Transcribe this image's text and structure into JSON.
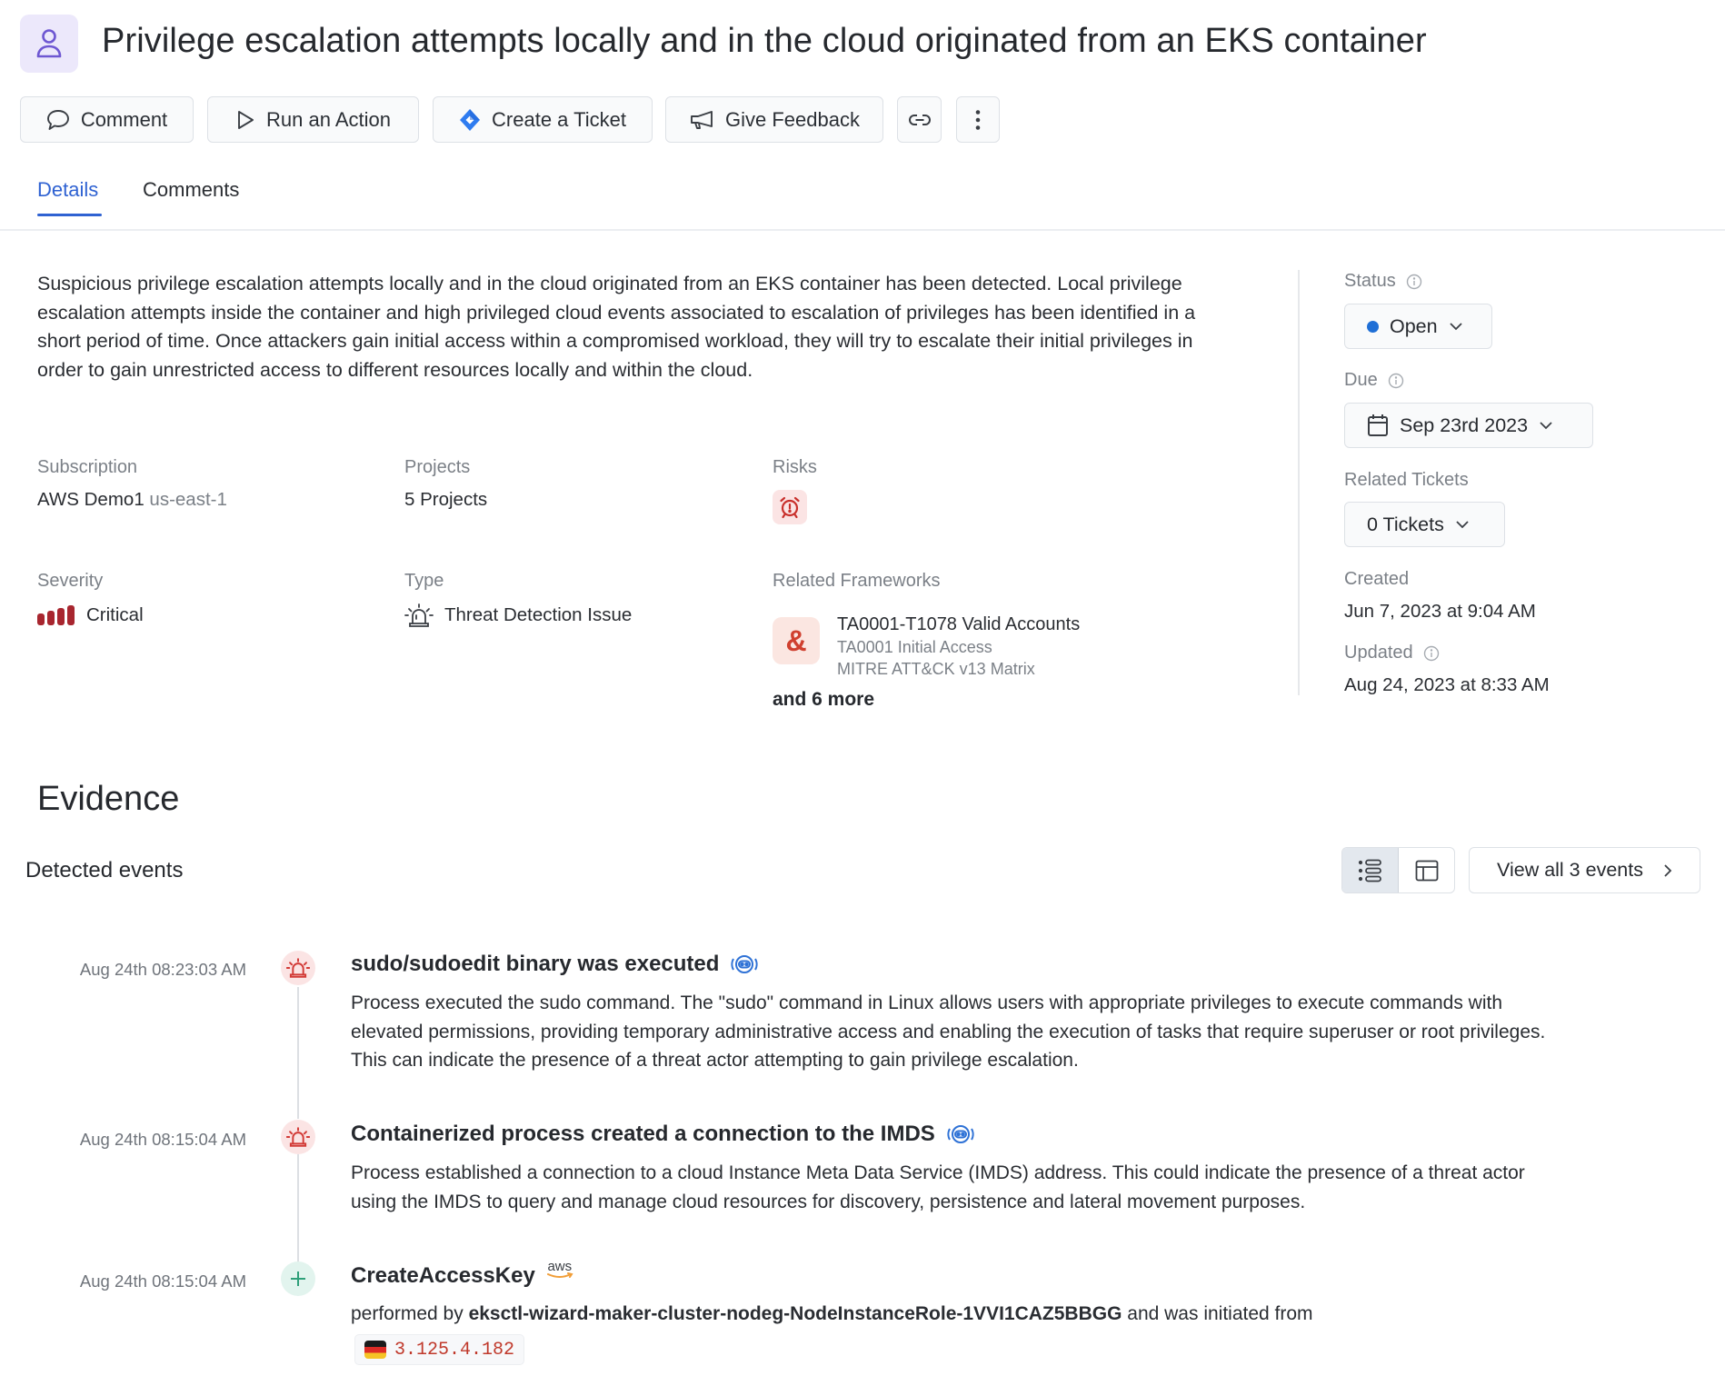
{
  "header": {
    "icon": "user-icon",
    "title": "Privilege escalation attempts locally and in the cloud originated from an EKS container"
  },
  "toolbar": {
    "comment": {
      "label": "Comment",
      "icon": "speech-bubble-icon"
    },
    "run_action": {
      "label": "Run an Action",
      "icon": "play-icon"
    },
    "create_ticket": {
      "label": "Create a Ticket",
      "icon": "jira-icon"
    },
    "give_feedback": {
      "label": "Give Feedback",
      "icon": "megaphone-icon"
    },
    "copy_link": {
      "icon": "link-icon"
    },
    "more": {
      "icon": "more-vertical-icon"
    }
  },
  "tabs": [
    {
      "label": "Details",
      "active": true
    },
    {
      "label": "Comments",
      "active": false
    }
  ],
  "details": {
    "description": "Suspicious privilege escalation attempts locally and in the cloud originated from an EKS container has been detected. Local privilege escalation attempts inside the container and high privileged cloud events associated to escalation of privileges has been identified in a short period of time. Once attackers gain initial access within a compromised workload, they will try to escalate their initial privileges in order to gain unrestricted access to different resources locally and within the cloud.",
    "subscription": {
      "label": "Subscription",
      "name": "AWS Demo1",
      "region": "us-east-1"
    },
    "projects": {
      "label": "Projects",
      "value": "5 Projects"
    },
    "risks": {
      "label": "Risks",
      "icon": "alarm-clock-icon"
    },
    "severity": {
      "label": "Severity",
      "value": "Critical",
      "level": 4,
      "max_level": 4,
      "color": "#a8262f"
    },
    "type": {
      "label": "Type",
      "value": "Threat Detection Issue",
      "icon": "siren-icon"
    },
    "frameworks": {
      "label": "Related Frameworks",
      "item": {
        "icon": "ampersand-icon",
        "title": "TA0001-T1078 Valid Accounts",
        "tactic": "TA0001 Initial Access",
        "matrix": "MITRE ATT&CK v13 Matrix"
      },
      "more": "and 6 more"
    }
  },
  "sidebar": {
    "status": {
      "label": "Status",
      "value": "Open",
      "dot_color": "#1f6fd6"
    },
    "due": {
      "label": "Due",
      "value": "Sep 23rd 2023"
    },
    "related_tickets": {
      "label": "Related Tickets",
      "value": "0 Tickets"
    },
    "created": {
      "label": "Created",
      "value": "Jun 7, 2023 at 9:04 AM"
    },
    "updated": {
      "label": "Updated",
      "value": "Aug 24, 2023 at 8:33 AM"
    }
  },
  "evidence": {
    "title": "Evidence",
    "subtitle": "Detected events",
    "view_all": "View all 3 events",
    "view_modes": [
      "timeline",
      "table"
    ],
    "active_view": "timeline",
    "events": [
      {
        "timestamp": "Aug 24th 08:23:03 AM",
        "kind": "threat",
        "title": "sudo/sudoedit binary was executed",
        "source_icon": "sensor-icon",
        "description": "Process executed the sudo command. The \"sudo\" command in Linux allows users with appropriate privileges to execute commands with elevated permissions, providing temporary administrative access and enabling the execution of tasks that require superuser or root privileges. This can indicate the presence of a threat actor attempting to gain privilege escalation."
      },
      {
        "timestamp": "Aug 24th 08:15:04 AM",
        "kind": "threat",
        "title": "Containerized process created a connection to the IMDS",
        "source_icon": "sensor-icon",
        "description": "Process established a connection to a cloud Instance Meta Data Service (IMDS) address. This could indicate the presence of a threat actor using the IMDS to query and manage cloud resources for discovery, persistence and lateral movement purposes."
      },
      {
        "timestamp": "Aug 24th 08:15:04 AM",
        "kind": "create",
        "title": "CreateAccessKey",
        "source_icon": "aws-logo-icon",
        "source_label": "aws",
        "performed_prefix": "performed by",
        "actor": "eksctl-wizard-maker-cluster-nodeg-NodeInstanceRole-1VVI1CAZ5BBGG",
        "performed_suffix": "and was initiated from",
        "ip": "3.125.4.182",
        "ip_country_flag": "germany-flag-icon"
      }
    ]
  }
}
